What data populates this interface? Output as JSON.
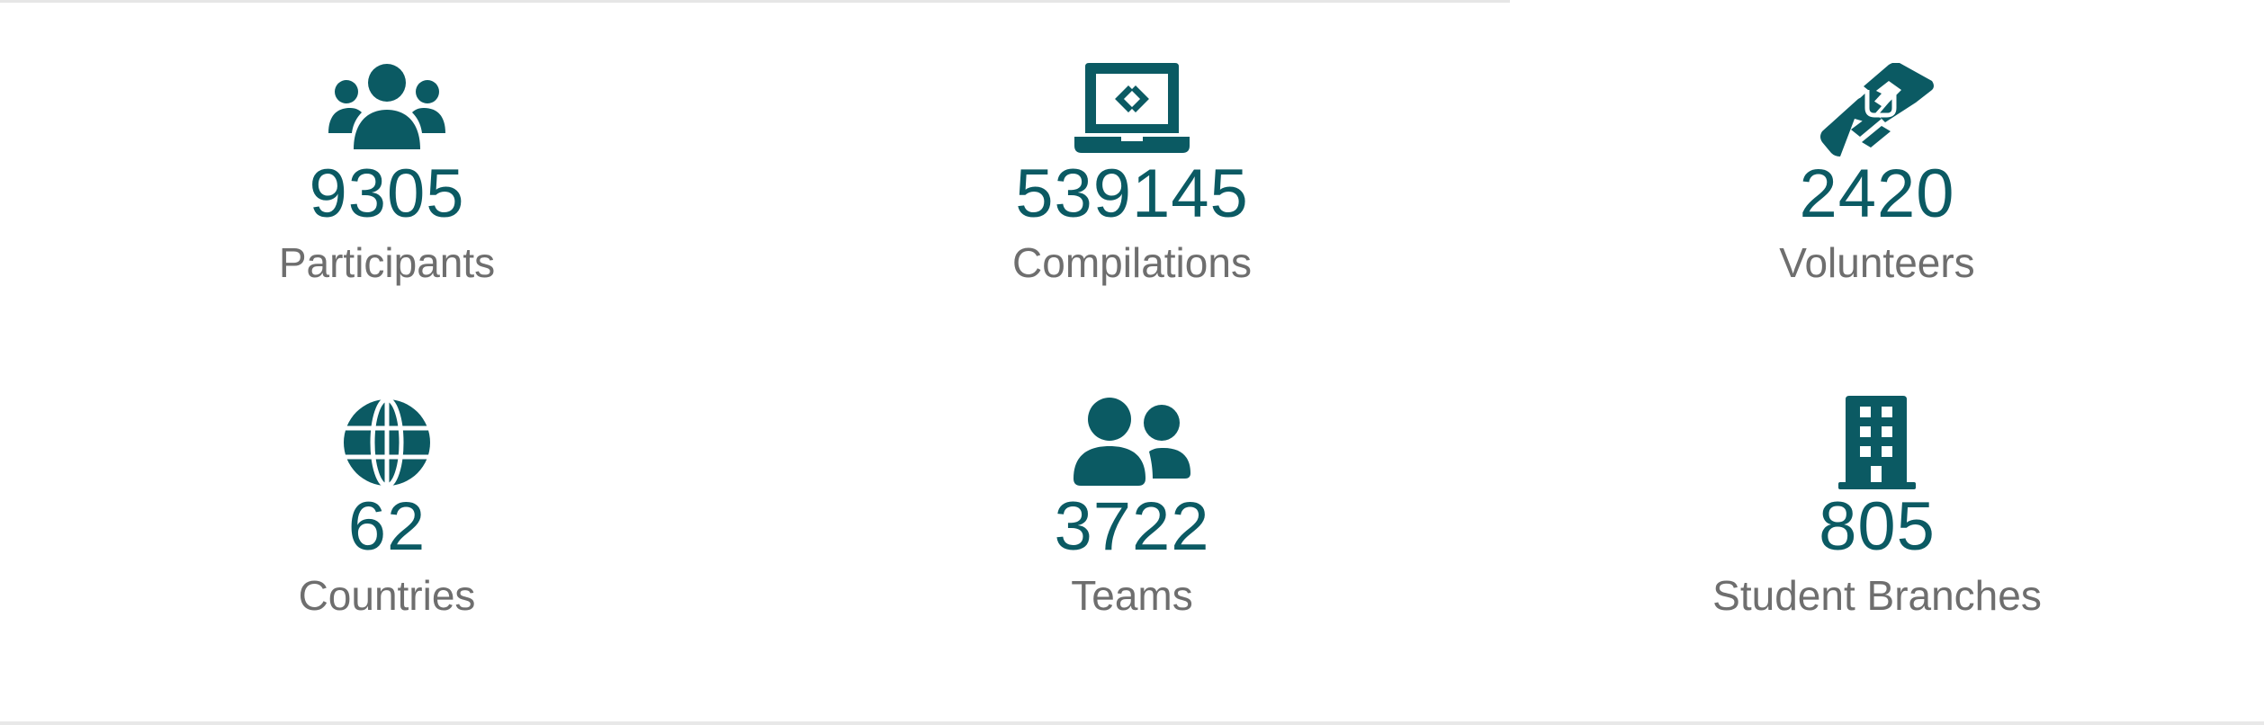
{
  "colors": {
    "accent": "#0b5a63",
    "label": "#6e6e6e",
    "background": "#ffffff"
  },
  "stats": [
    {
      "icon": "participants-icon",
      "value": "9305",
      "label": "Participants"
    },
    {
      "icon": "laptop-code-icon",
      "value": "539145",
      "label": "Compilations"
    },
    {
      "icon": "helping-hands-icon",
      "value": "2420",
      "label": "Volunteers"
    },
    {
      "icon": "globe-icon",
      "value": "62",
      "label": "Countries"
    },
    {
      "icon": "team-icon",
      "value": "3722",
      "label": "Teams"
    },
    {
      "icon": "building-icon",
      "value": "805",
      "label": "Student Branches"
    }
  ]
}
